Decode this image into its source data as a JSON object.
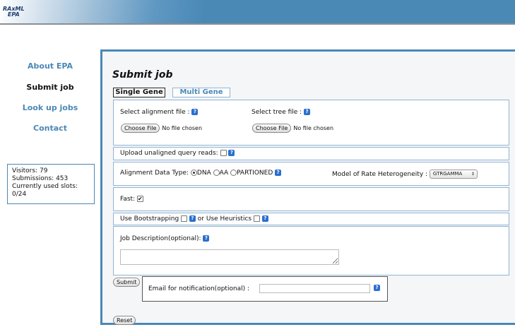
{
  "header": {
    "logo_line1": "RAxML",
    "logo_line2": "EPA",
    "brand_color": "#4a88b6"
  },
  "sidebar": {
    "items": [
      {
        "label": "About EPA"
      },
      {
        "label": "Submit job"
      },
      {
        "label": "Look up jobs"
      },
      {
        "label": "Contact"
      }
    ],
    "stats": {
      "visitors": "Visitors: 79",
      "submissions": "Submissions: 453",
      "slots_label": "Currently used slots:",
      "slots_value": "0/24"
    }
  },
  "main": {
    "title": "Submit job",
    "tabs": [
      {
        "label": "Single Gene",
        "active": true
      },
      {
        "label": "Multi Gene",
        "active": false
      }
    ],
    "alignment_label": "Select alignment file :",
    "tree_label": "Select tree file :",
    "choose_file": "Choose File",
    "no_file": "No file chosen",
    "upload_label": "Upload unaligned query reads:",
    "data_type_label": "Alignment Data Type:",
    "data_types": [
      {
        "label": "DNA",
        "checked": true
      },
      {
        "label": "AA",
        "checked": false
      },
      {
        "label": "PARTIONED",
        "checked": false
      }
    ],
    "model_label": "Model of Rate Heterogeneity :",
    "model_value": "GTRGAMMA",
    "fast_label": "Fast:",
    "fast_checked": true,
    "bootstrap_label": "Use Bootstrapping",
    "or_heuristics_label": "or Use Heuristics",
    "job_desc_label": "Job Description(optional):",
    "job_desc_value": "",
    "submit_label": "Submit",
    "email_label": "Email for notification(optional) :",
    "email_value": "",
    "reset_label": "Reset",
    "help_glyph": "?"
  }
}
